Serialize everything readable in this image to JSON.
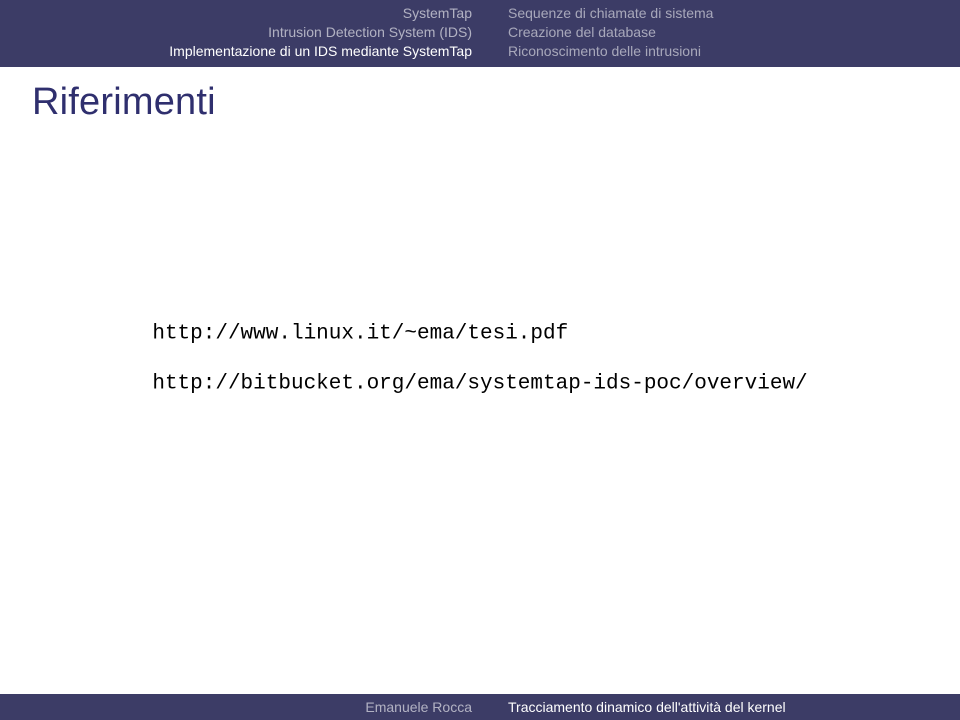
{
  "header": {
    "left": {
      "row1": "SystemTap",
      "row2": "Intrusion Detection System (IDS)",
      "row3": "Implementazione di un IDS mediante SystemTap"
    },
    "right": {
      "row1": "Sequenze di chiamate di sistema",
      "row2": "Creazione del database",
      "row3": "Riconoscimento delle intrusioni"
    }
  },
  "title": "Riferimenti",
  "links": {
    "link1": "http://www.linux.it/~ema/tesi.pdf",
    "link2": "http://bitbucket.org/ema/systemtap-ids-poc/overview/"
  },
  "footer": {
    "author": "Emanuele Rocca",
    "talk": "Tracciamento dinamico dell'attività del kernel"
  }
}
